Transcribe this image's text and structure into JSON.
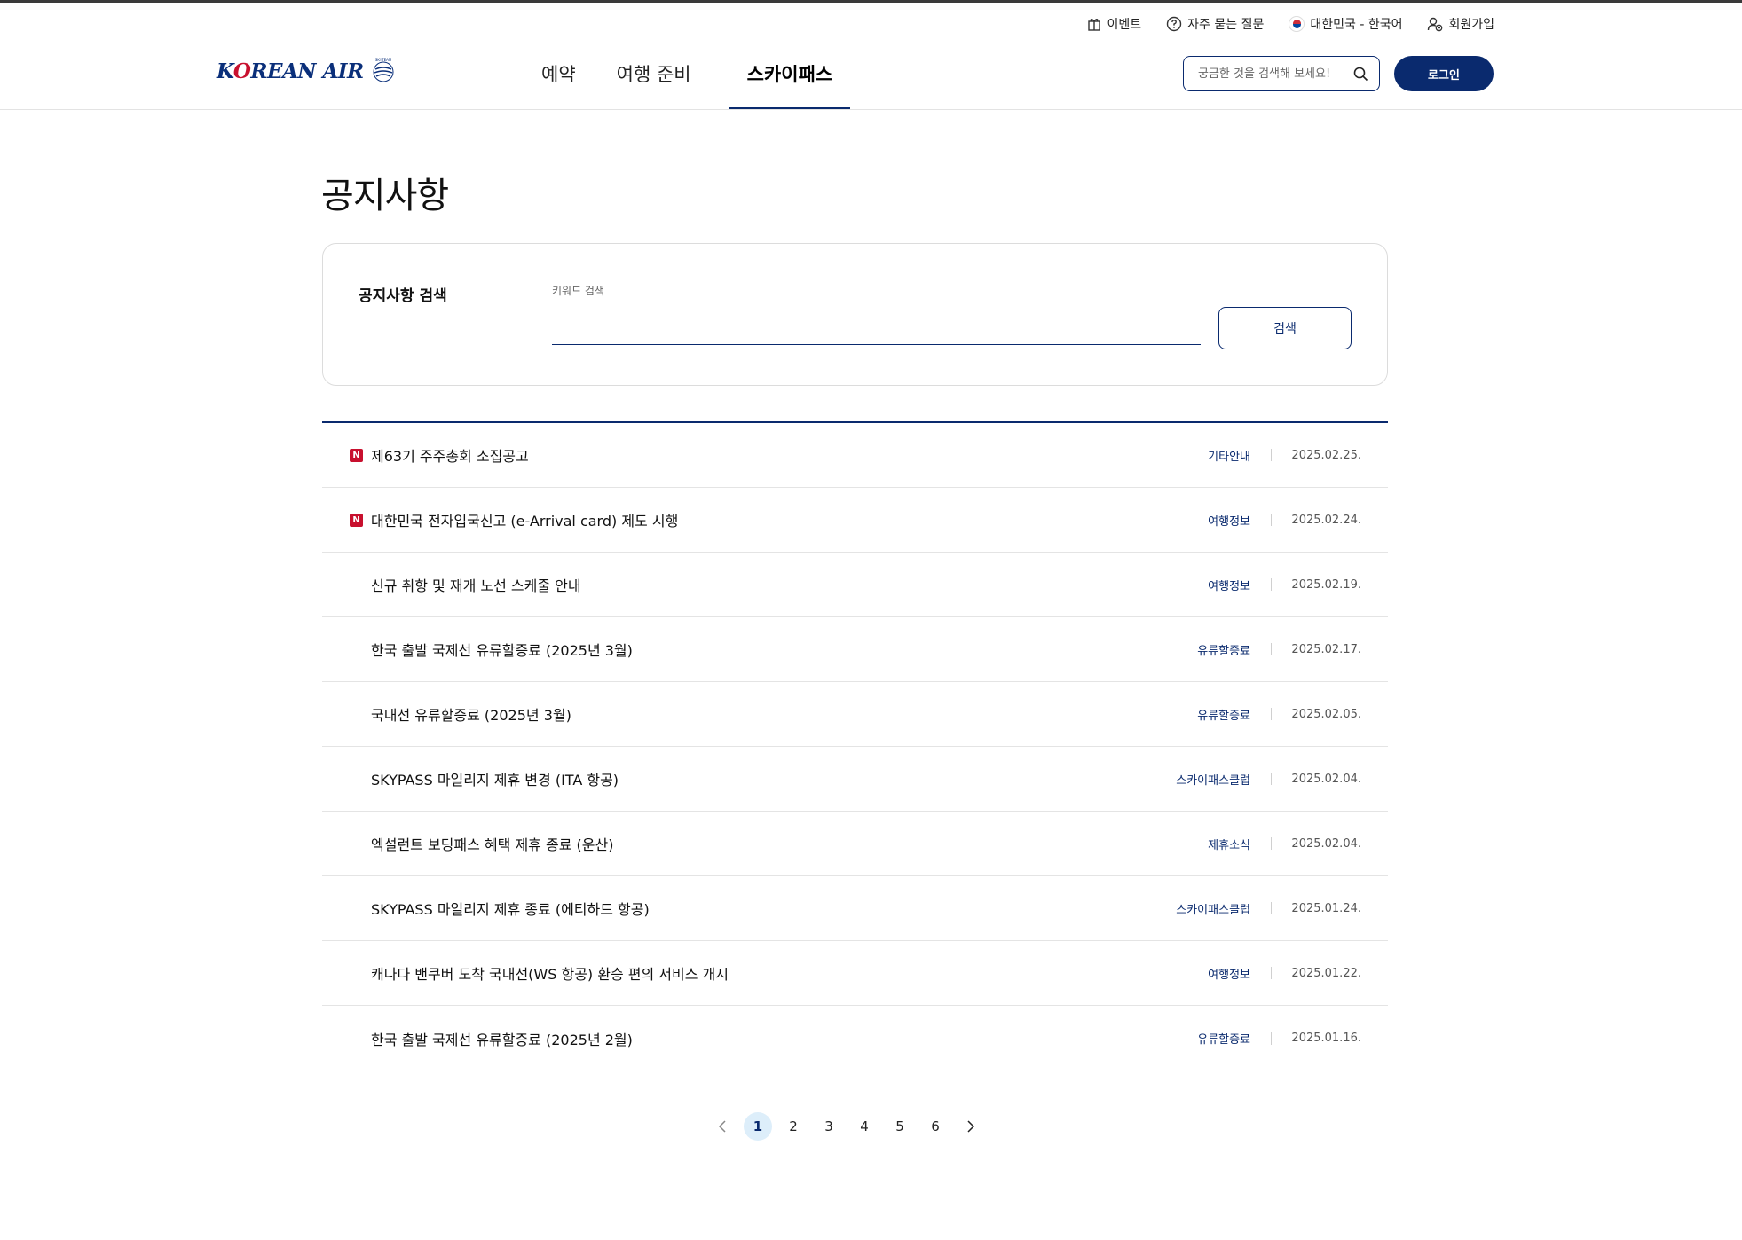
{
  "utility": {
    "events": "이벤트",
    "faq": "자주 묻는 질문",
    "locale": "대한민국 - 한국어",
    "signup": "회원가입"
  },
  "brand": {
    "logo_text_k": "K",
    "logo_text_o": "O",
    "logo_text_rest": "REAN AIR",
    "logo_mark": "SKYTEAM",
    "brand_color": "#0a2a6e",
    "accent_color": "#c8102e"
  },
  "nav": {
    "items": [
      {
        "label": "예약",
        "active": false
      },
      {
        "label": "여행 준비",
        "active": false
      },
      {
        "label": "스카이패스",
        "active": true
      }
    ]
  },
  "header_search": {
    "placeholder": "궁금한 것을 검색해 보세요!"
  },
  "login": {
    "label": "로그인"
  },
  "page": {
    "title": "공지사항"
  },
  "notice_search": {
    "title": "공지사항 검색",
    "keyword_label": "키워드 검색",
    "keyword_value": "",
    "button": "검색"
  },
  "notices": [
    {
      "new": true,
      "badge": "N",
      "title": "제63기 주주총회 소집공고",
      "category": "기타안내",
      "date": "2025.02.25."
    },
    {
      "new": true,
      "badge": "N",
      "title": "대한민국 전자입국신고 (e-Arrival card) 제도 시행",
      "category": "여행정보",
      "date": "2025.02.24."
    },
    {
      "new": false,
      "badge": "",
      "title": "신규 취항 및 재개 노선 스케줄 안내",
      "category": "여행정보",
      "date": "2025.02.19."
    },
    {
      "new": false,
      "badge": "",
      "title": "한국 출발 국제선 유류할증료 (2025년 3월)",
      "category": "유류할증료",
      "date": "2025.02.17."
    },
    {
      "new": false,
      "badge": "",
      "title": "국내선 유류할증료 (2025년 3월)",
      "category": "유류할증료",
      "date": "2025.02.05."
    },
    {
      "new": false,
      "badge": "",
      "title": "SKYPASS 마일리지 제휴 변경 (ITA 항공)",
      "category": "스카이패스클럽",
      "date": "2025.02.04."
    },
    {
      "new": false,
      "badge": "",
      "title": "엑설런트 보딩패스 혜택 제휴 종료 (운산)",
      "category": "제휴소식",
      "date": "2025.02.04."
    },
    {
      "new": false,
      "badge": "",
      "title": "SKYPASS 마일리지 제휴 종료 (에티하드 항공)",
      "category": "스카이패스클럽",
      "date": "2025.01.24."
    },
    {
      "new": false,
      "badge": "",
      "title": "캐나다 밴쿠버 도착 국내선(WS 항공) 환승 편의 서비스 개시",
      "category": "여행정보",
      "date": "2025.01.22."
    },
    {
      "new": false,
      "badge": "",
      "title": "한국 출발 국제선 유류할증료 (2025년 2월)",
      "category": "유류할증료",
      "date": "2025.01.16."
    }
  ],
  "pagination": {
    "current": 1,
    "pages": [
      "1",
      "2",
      "3",
      "4",
      "5",
      "6"
    ]
  }
}
